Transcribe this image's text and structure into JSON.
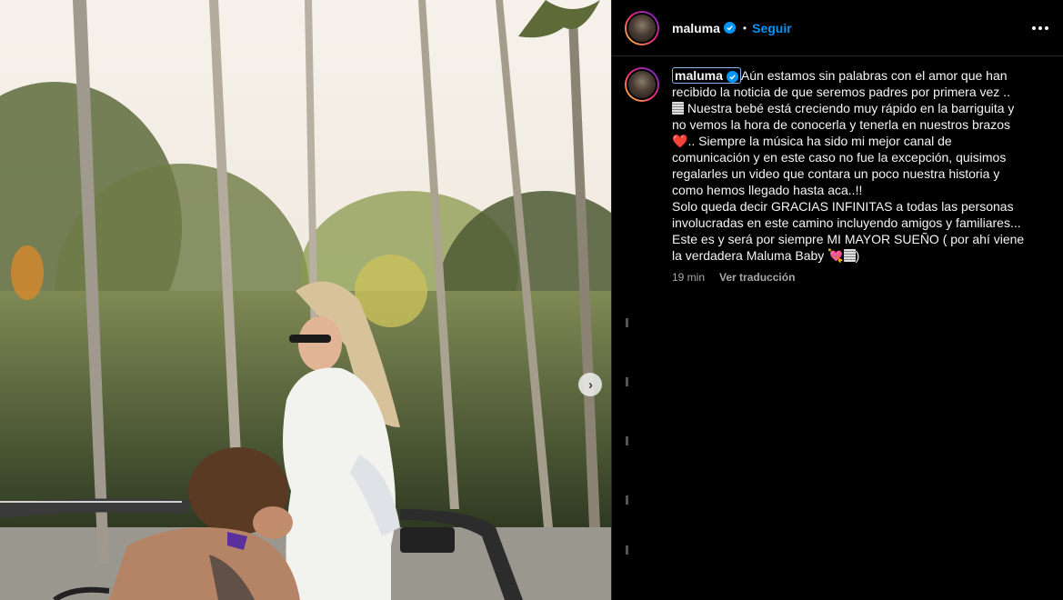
{
  "post": {
    "username": "maluma",
    "follow_label": "Seguir",
    "separator": "•"
  },
  "caption": {
    "username": "maluma",
    "lines": [
      "Aún estamos sin palabras con el amor que han",
      "recibido la noticia de que seremos padres por primera vez ..",
      "Nuestra bebé está creciendo muy rápido en la barriguita y",
      "no vemos la hora de conocerla y tenerla en nuestros brazos",
      ".. Siempre la música ha sido mi mejor canal de",
      "comunicación y en este caso no fue la excepción, quisimos",
      "regalarles un video que contara un poco nuestra historia y",
      "como hemos llegado hasta aca..!!",
      "Solo queda decir GRACIAS INFINITAS a todas las personas",
      "involucradas en este camino incluyendo amigos y familiares...",
      "Este es y será por siempre MI MAYOR SUEÑO ( por ahí viene",
      "la verdadera Maluma Baby",
      ")"
    ],
    "emoji_heart": "❤️",
    "emoji_pink_heart": "💘",
    "time": "19 min",
    "translate_label": "Ver traducción"
  },
  "media": {
    "next_icon": "chevron-right-icon"
  },
  "colors": {
    "accent": "#0095f6",
    "background": "#000000",
    "muted": "#a8a8a8"
  }
}
